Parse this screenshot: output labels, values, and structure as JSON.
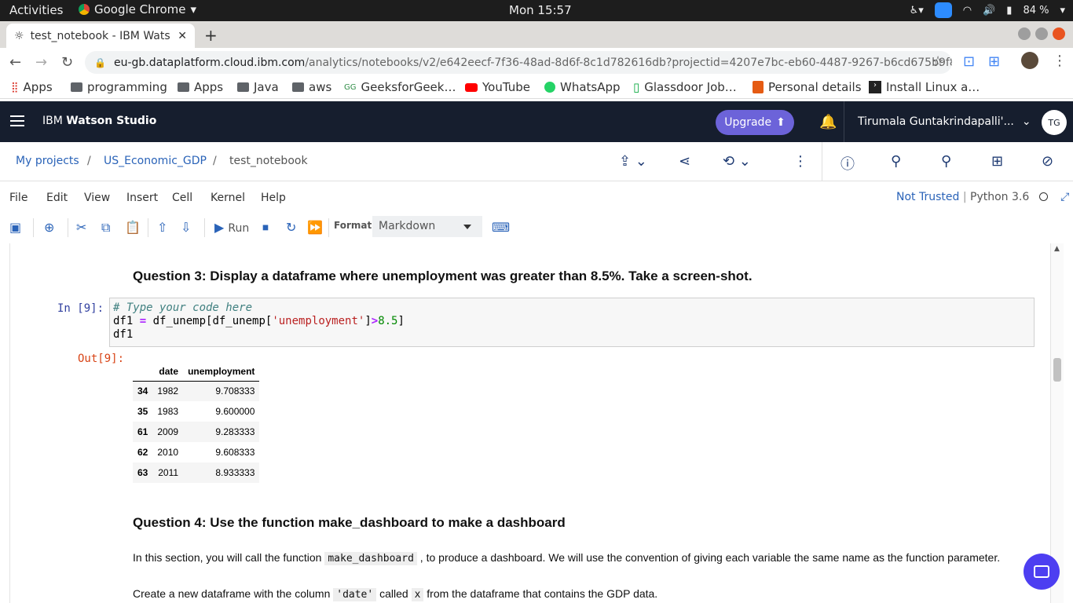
{
  "os": {
    "activities": "Activities",
    "app_name": "Google Chrome",
    "clock": "Mon 15:57",
    "battery": "84 %"
  },
  "browser": {
    "tab_title": "test_notebook - IBM Wats",
    "url_host": "eu-gb.dataplatform.cloud.ibm.com",
    "url_path": "/analytics/notebooks/v2/e642eecf-7f36-48ad-8d6f-8c1d782616db?projectid=4207e7bc-eb60-4487-9267-b6cd675b9f8e&conte…",
    "bookmarks": [
      "Apps",
      "programming",
      "Apps",
      "Java",
      "aws",
      "GeeksforGeek…",
      "YouTube",
      "WhatsApp",
      "Glassdoor Job…",
      "Personal details",
      "Install Linux a…"
    ]
  },
  "header": {
    "brand_prefix": "IBM ",
    "brand_name": "Watson Studio",
    "upgrade_label": "Upgrade",
    "user_name": "Tirumala Guntakrindapalli'...",
    "avatar_initials": "TG"
  },
  "breadcrumb": {
    "items": [
      "My projects",
      "US_Economic_GDP",
      "test_notebook"
    ],
    "separator": "/"
  },
  "menubar": {
    "items": [
      "File",
      "Edit",
      "View",
      "Insert",
      "Cell",
      "Kernel",
      "Help"
    ],
    "trust": "Not Trusted",
    "kernel": "Python 3.6"
  },
  "toolbar": {
    "run_label": "Run",
    "format_label": "Format",
    "format_value": "Markdown"
  },
  "notebook": {
    "q3_heading": "Question 3: Display a dataframe where unemployment was greater than 8.5%. Take a screen-shot.",
    "in_prompt": "In [9]:",
    "out_prompt": "Out[9]:",
    "code_comment": "# Type your code here",
    "code_line2_a": "df1 ",
    "code_line2_op": "=",
    "code_line2_b": " df_unemp[df_unemp[",
    "code_line2_str": "'unemployment'",
    "code_line2_c": "]",
    "code_line2_op2": ">",
    "code_line2_num": "8.5",
    "code_line2_d": "]",
    "code_line3": "df1",
    "table_columns": [
      "date",
      "unemployment"
    ],
    "table_rows": [
      {
        "idx": "34",
        "date": "1982",
        "unemployment": "9.708333"
      },
      {
        "idx": "35",
        "date": "1983",
        "unemployment": "9.600000"
      },
      {
        "idx": "61",
        "date": "2009",
        "unemployment": "9.283333"
      },
      {
        "idx": "62",
        "date": "2010",
        "unemployment": "9.608333"
      },
      {
        "idx": "63",
        "date": "2011",
        "unemployment": "8.933333"
      }
    ],
    "q4_heading": "Question 4: Use the function make_dashboard to make a dashboard",
    "p1_a": "In this section, you will call the function ",
    "p1_code": "make_dashboard",
    "p1_b": " , to produce a dashboard. We will use the convention of giving each variable the same name as the function parameter.",
    "p2_a": "Create a new dataframe with the column ",
    "p2_code1": "'date'",
    "p2_b": " called ",
    "p2_code2": "x",
    "p2_c": " from the dataframe that contains the GDP data."
  }
}
